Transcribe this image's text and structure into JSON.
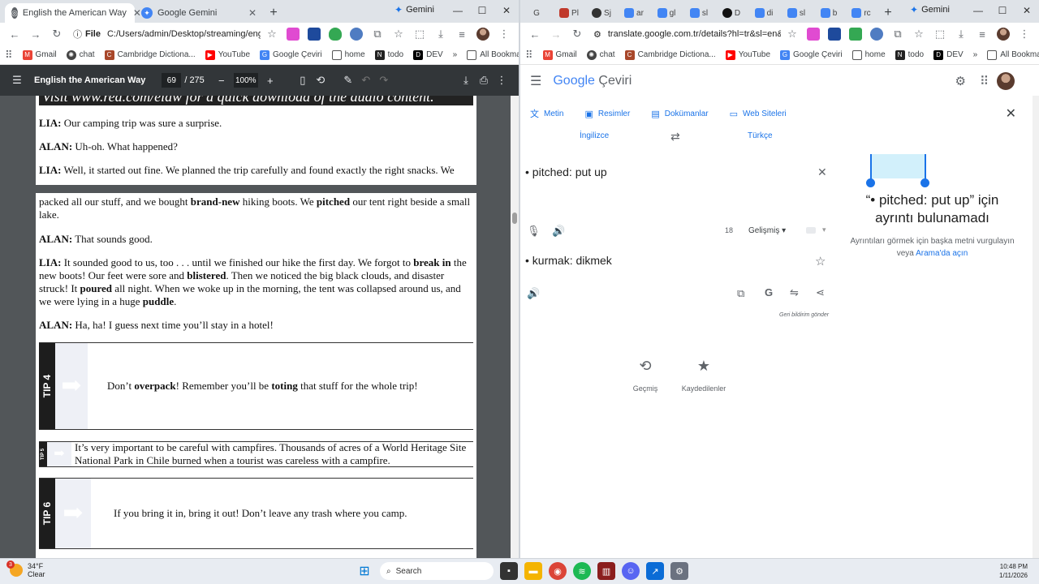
{
  "left": {
    "tabs": [
      {
        "label": "English the American Way",
        "active": true
      },
      {
        "label": "Google Gemini",
        "active": false
      }
    ],
    "gemini_label": "Gemini",
    "url_chip": "File",
    "url": "C:/Users/admin/Desktop/streaming/english/...",
    "bookmarks": [
      "Gmail",
      "chat",
      "Cambridge Dictiona...",
      "YouTube",
      "Google Çeviri",
      "home",
      "todo",
      "DEV"
    ],
    "all_bookmarks": "All Bookmarks",
    "pdf": {
      "title": "English the American Way",
      "page": "69",
      "total": "/ 275",
      "zoom": "100%"
    },
    "doc": {
      "banner": "Visit www.rea.com/elaw for a quick download of the audio content.",
      "l1_spk": "LIA:",
      "l1": "Our camping trip was sure a surprise.",
      "l2_spk": "ALAN:",
      "l2": "Uh-oh. What happened?",
      "l3_spk": "LIA:",
      "l3": "Well, it started out fine. We planned the trip carefully and found exactly the right snacks. We",
      "p2_a": "packed all our stuff, and we bought ",
      "p2_b": "brand-new",
      "p2_c": " hiking boots. We ",
      "p2_d": "pitched",
      "p2_e": " our tent right beside a small lake.",
      "l4_spk": "ALAN:",
      "l4": "That sounds good.",
      "l5_spk": "LIA:",
      "l5_a": "It sounded good to us, too . . . until we finished our hike the first day. We forgot to ",
      "l5_b": "break in",
      "l5_c": " the new boots! Our feet were sore and ",
      "l5_d": "blistered",
      "l5_e": ". Then we noticed the big black clouds, and disaster struck! It ",
      "l5_f": "poured",
      "l5_g": " all night. When we woke up in the morning, the tent was collapsed around us, and we were lying in a huge ",
      "l5_h": "puddle",
      "l5_i": ".",
      "l6_spk": "ALAN:",
      "l6": "Ha, ha! I guess next time you’ll stay in a hotel!",
      "tip4_label": "TIP 4",
      "tip4_a": "Don’t ",
      "tip4_b": "overpack",
      "tip4_c": "! Remember you’ll be ",
      "tip4_d": "toting",
      "tip4_e": " that stuff for the whole trip!",
      "tip5_label": "TIP 5",
      "tip5": "It’s very important to be careful with campfires. Thousands of acres of a World Heritage Site National Park in Chile burned when a tourist was careless with a campfire.",
      "tip6_label": "TIP 6",
      "tip6": "If you bring it in, bring it out! Don’t leave any trash where you camp."
    }
  },
  "right": {
    "tabs": [
      "G",
      "Pl",
      "Sj",
      "ar",
      "gl",
      "sl",
      "D",
      "di",
      "sl",
      "b",
      "rc"
    ],
    "gemini_label": "Gemini",
    "url": "translate.google.com.tr/details?hl=tr&sl=en&tl=...",
    "bookmarks": [
      "Gmail",
      "chat",
      "Cambridge Dictiona...",
      "YouTube",
      "Google Çeviri",
      "home",
      "todo",
      "DEV"
    ],
    "all_bookmarks": "All Bookmarks",
    "translate": {
      "logo_google": "Google",
      "logo_product": "Çeviri",
      "modes": [
        "Metin",
        "Resimler",
        "Dokümanlar",
        "Web Siteleri"
      ],
      "source_lang": "İngilizce",
      "target_lang": "Türkçe",
      "source_text": "• pitched: put up",
      "char_count": "18",
      "advanced": "Gelişmiş",
      "target_text": "• kurmak: dikmek",
      "feedback": "Geri bildirim gönder",
      "side_heading": "“• pitched: put up” için ayrıntı bulunamadı",
      "side_sub": "Ayrıntıları görmek için başka metni vurgulayın veya",
      "side_link": "Arama'da açın",
      "history": "Geçmiş",
      "saved": "Kaydedilenler"
    }
  },
  "taskbar": {
    "temp": "34°F",
    "cond": "Clear",
    "weather_badge": "3",
    "search": "Search",
    "time": "10:48 PM",
    "date": "1/11/2026"
  }
}
